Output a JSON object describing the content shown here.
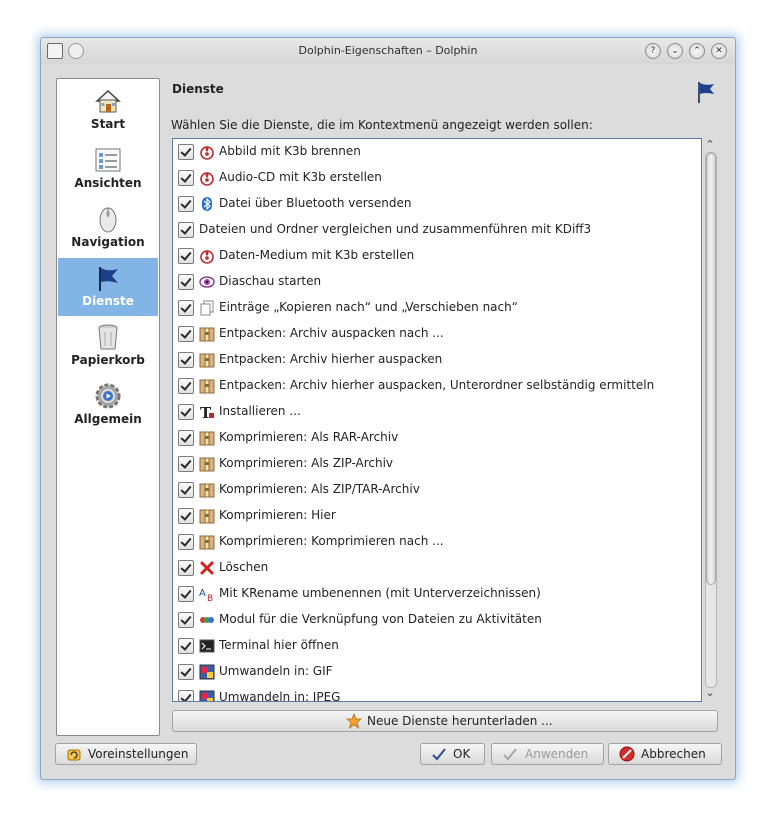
{
  "window": {
    "title": "Dolphin-Eigenschaften – Dolphin"
  },
  "titlebar_buttons": [
    "?",
    "⌄",
    "⌃",
    "✕"
  ],
  "sidebar": {
    "items": [
      {
        "label": "Start",
        "icon": "home-icon"
      },
      {
        "label": "Ansichten",
        "icon": "view-icon"
      },
      {
        "label": "Navigation",
        "icon": "mouse-icon"
      },
      {
        "label": "Dienste",
        "icon": "flag-icon",
        "active": true
      },
      {
        "label": "Papierkorb",
        "icon": "trash-icon"
      },
      {
        "label": "Allgemein",
        "icon": "gear-icon"
      }
    ]
  },
  "panel": {
    "title": "Dienste",
    "instructions": "Wählen Sie die Dienste, die im Kontextmenü angezeigt werden sollen:"
  },
  "services": [
    {
      "label": "Abbild mit K3b brennen",
      "icon": "k3b-icon",
      "checked": true
    },
    {
      "label": "Audio-CD mit K3b erstellen",
      "icon": "k3b-icon",
      "checked": true
    },
    {
      "label": "Datei über Bluetooth versenden",
      "icon": "bluetooth-icon",
      "checked": true
    },
    {
      "label": "Dateien und Ordner vergleichen und zusammenführen mit KDiff3",
      "icon": "",
      "checked": true
    },
    {
      "label": "Daten-Medium mit K3b erstellen",
      "icon": "k3b-icon",
      "checked": true
    },
    {
      "label": "Diaschau starten",
      "icon": "eye-icon",
      "checked": true
    },
    {
      "label": "Einträge „Kopieren nach“ und „Verschieben nach“",
      "icon": "copy-icon",
      "checked": true
    },
    {
      "label": "Entpacken: Archiv auspacken nach ...",
      "icon": "archive-icon",
      "checked": true
    },
    {
      "label": "Entpacken: Archiv hierher auspacken",
      "icon": "archive-icon",
      "checked": true
    },
    {
      "label": "Entpacken: Archiv hierher auspacken, Unterordner selbständig ermitteln",
      "icon": "archive-icon",
      "checked": true
    },
    {
      "label": "Installieren ...",
      "icon": "font-icon",
      "checked": true
    },
    {
      "label": "Komprimieren: Als RAR-Archiv",
      "icon": "archive-icon",
      "checked": true
    },
    {
      "label": "Komprimieren: Als ZIP-Archiv",
      "icon": "archive-icon",
      "checked": true
    },
    {
      "label": "Komprimieren: Als ZIP/TAR-Archiv",
      "icon": "archive-icon",
      "checked": true
    },
    {
      "label": "Komprimieren: Hier",
      "icon": "archive-icon",
      "checked": true
    },
    {
      "label": "Komprimieren: Komprimieren nach ...",
      "icon": "archive-icon",
      "checked": true
    },
    {
      "label": "Löschen",
      "icon": "delete-icon",
      "checked": true
    },
    {
      "label": "Mit KRename umbenennen (mit Unterverzeichnissen)",
      "icon": "rename-icon",
      "checked": true
    },
    {
      "label": "Modul für die Verknüpfung von Dateien zu Aktivitäten",
      "icon": "activities-icon",
      "checked": true
    },
    {
      "label": "Terminal hier öffnen",
      "icon": "terminal-icon",
      "checked": true
    },
    {
      "label": "Umwandeln in: GIF",
      "icon": "image-icon",
      "checked": true
    },
    {
      "label": "Umwandeln in: JPEG",
      "icon": "image-icon",
      "checked": true
    }
  ],
  "download_button": "Neue Dienste herunterladen ...",
  "footer": {
    "defaults": "Voreinstellungen",
    "ok": "OK",
    "apply": "Anwenden",
    "cancel": "Abbrechen"
  },
  "colors": {
    "selection": "#82b5e6",
    "list_border": "#5c7ea4"
  }
}
